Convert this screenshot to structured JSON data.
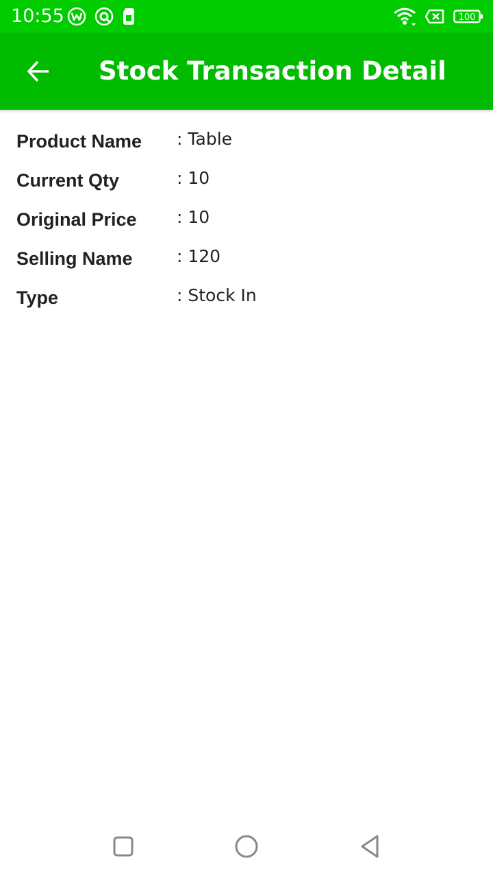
{
  "status_bar": {
    "time": "10:55",
    "battery": "100",
    "icons": [
      "notification-w-icon",
      "notification-q-icon",
      "sim-card-icon",
      "wifi-icon",
      "no-sim-icon",
      "battery-icon"
    ]
  },
  "app_bar": {
    "title": "Stock Transaction Detail",
    "back_icon": "arrow-back-icon",
    "color": "#00bb00"
  },
  "details": [
    {
      "label": "Product Name",
      "value": ": Table"
    },
    {
      "label": "Current Qty",
      "value": ": 10"
    },
    {
      "label": "Original Price",
      "value": ": 10"
    },
    {
      "label": "Selling Name",
      "value": ": 120"
    },
    {
      "label": "Type",
      "value": ": Stock In"
    }
  ],
  "nav_bar": {
    "icons": [
      "recent-apps-icon",
      "home-icon",
      "back-icon"
    ]
  },
  "colors": {
    "status_bar": "#00cc00",
    "app_bar": "#00bb00",
    "text": "#222222"
  }
}
